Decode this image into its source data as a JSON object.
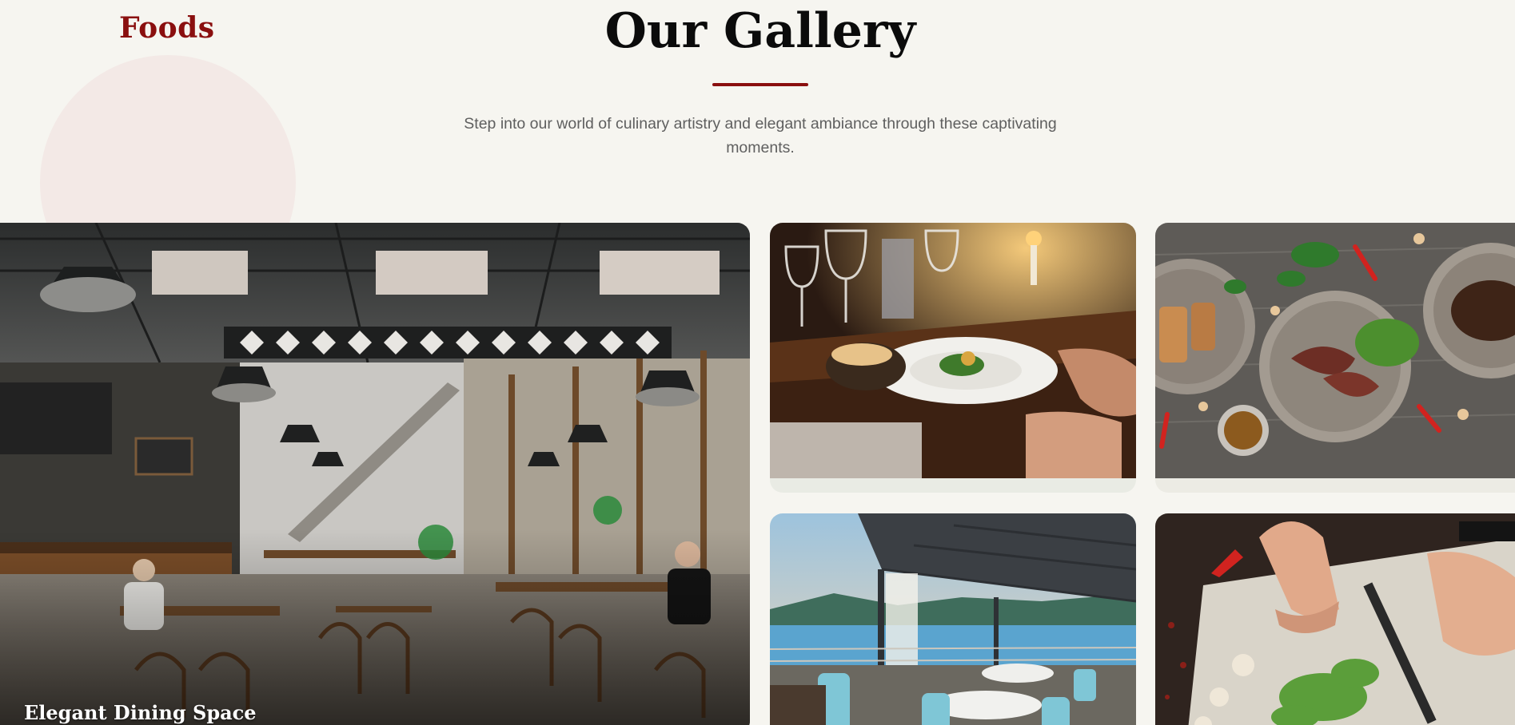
{
  "header": {
    "brand": "Foods",
    "title": "Our Gallery",
    "subtitle": "Step into our world of culinary artistry and elegant ambiance through these captivating moments."
  },
  "gallery": {
    "items": [
      {
        "image": "restaurant-interior-photo",
        "caption": "Elegant Dining Space"
      },
      {
        "image": "fine-dining-table-photo"
      },
      {
        "image": "plated-dishes-overhead-photo"
      },
      {
        "image": "lakeside-terrace-photo"
      },
      {
        "image": "chef-chopping-herbs-photo"
      }
    ]
  },
  "colors": {
    "accent": "#8a0f0f",
    "background": "#f6f5f0",
    "title": "#0b0b0b",
    "subtitle": "#5f5f5f",
    "decor_circle": "#f3e9e6"
  }
}
